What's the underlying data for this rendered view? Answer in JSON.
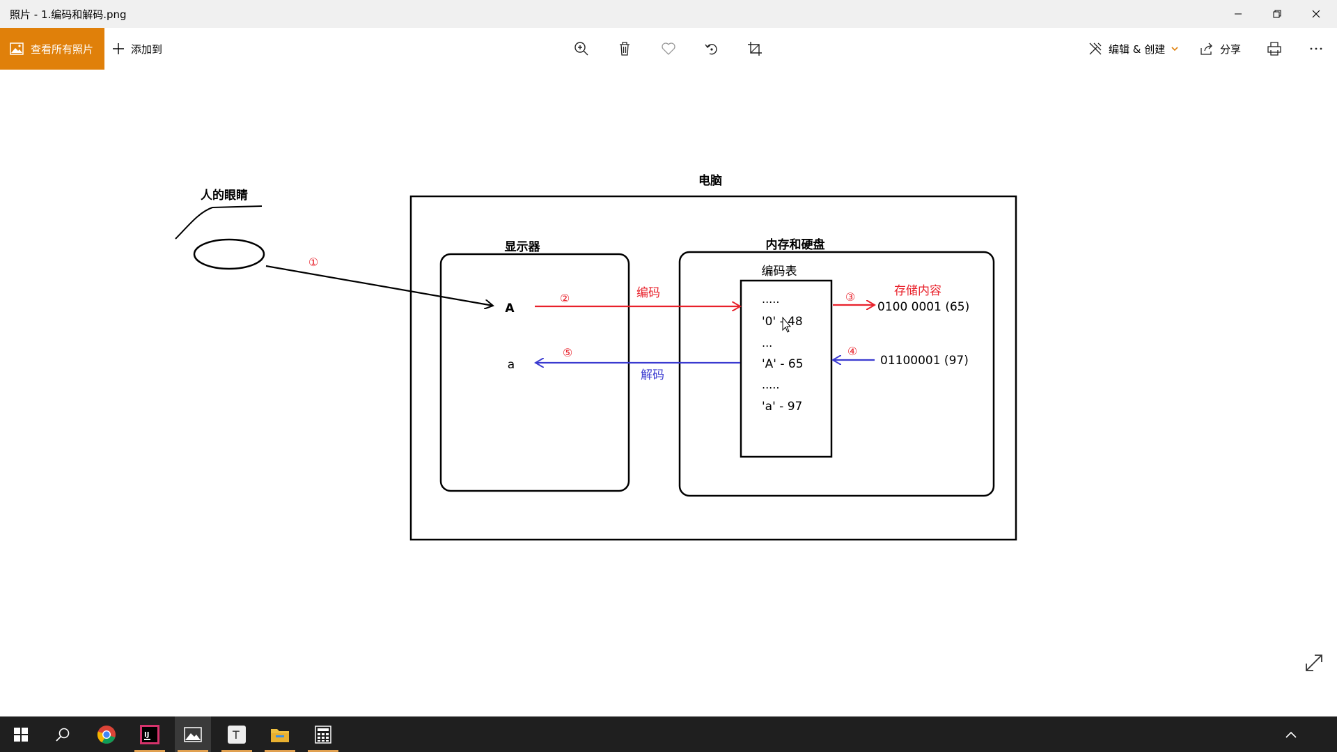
{
  "window": {
    "title": "照片 - 1.编码和解码.png"
  },
  "cmdbar": {
    "view_all_label": "查看所有照片",
    "add_to_label": "添加到",
    "edit_create_label": "编辑 & 创建",
    "share_label": "分享"
  },
  "diagram": {
    "computer_label": "电脑",
    "eye_label": "人的眼睛",
    "monitor_label": "显示器",
    "storage_label": "内存和硬盘",
    "code_table_label": "编码表",
    "stored_content_label": "存储内容",
    "encode_label": "编码",
    "decode_label": "解码",
    "step1": "①",
    "step2": "②",
    "step3": "③",
    "step4": "④",
    "step5": "⑤",
    "char_upper": "A",
    "char_lower": "a",
    "table_rows": [
      ".....",
      "'0' - 48",
      "...",
      "'A' - 65",
      ".....",
      "'a' - 97"
    ],
    "binary_upper": "0100 0001 (65)",
    "binary_lower": "01100001 (97)"
  },
  "colors": {
    "accent": "#e0800a",
    "encode_red": "#e8202a",
    "decode_blue": "#3a3ad0"
  }
}
